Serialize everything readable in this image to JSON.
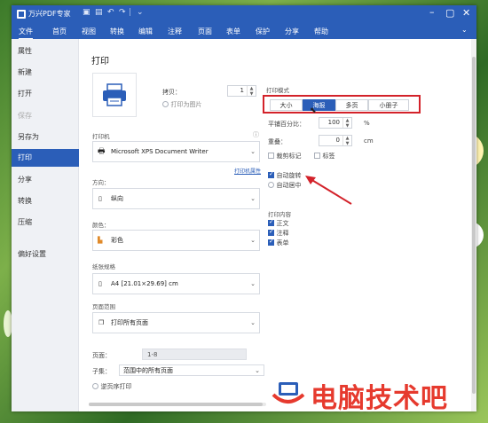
{
  "window": {
    "app_title": "万兴PDF专家",
    "quick_icons": [
      "save-icon",
      "print-icon",
      "undo-icon",
      "redo-icon",
      "customize-icon"
    ],
    "controls": [
      "minimize-icon",
      "maximize-icon",
      "close-icon"
    ]
  },
  "menubar": {
    "items": [
      "文件",
      "首页",
      "视图",
      "转换",
      "编辑",
      "注释",
      "页面",
      "表单",
      "保护",
      "分享",
      "帮助"
    ],
    "active": "文件"
  },
  "sidebar": {
    "items": [
      {
        "label": "属性",
        "state": "normal"
      },
      {
        "label": "新建",
        "state": "normal"
      },
      {
        "label": "打开",
        "state": "normal"
      },
      {
        "label": "保存",
        "state": "disabled"
      },
      {
        "label": "另存为",
        "state": "normal"
      },
      {
        "label": "打印",
        "state": "active"
      },
      {
        "label": "分享",
        "state": "normal"
      },
      {
        "label": "转换",
        "state": "normal"
      },
      {
        "label": "压缩",
        "state": "normal"
      },
      {
        "label": "偏好设置",
        "state": "normal"
      }
    ]
  },
  "print": {
    "title": "打印",
    "copies_label": "拷贝：",
    "copies_value": "1",
    "print_as_image_label": "打印为图片",
    "printer_label": "打印机",
    "printer_value": "Microsoft XPS Document Writer",
    "printer_properties_link": "打印机属性",
    "orientation_label": "方向：",
    "orientation_value": "纵向",
    "color_label": "颜色：",
    "color_value": "彩色",
    "paper_label": "纸张规格",
    "paper_value": "A4 [21.01×29.69] cm",
    "page_range_label": "页面范围",
    "page_range_value": "打印所有页面",
    "pages_label": "页面：",
    "pages_value": "1-8",
    "subset_label": "子集：",
    "subset_value": "范围中的所有页面",
    "reverse_label": "逆页序打印"
  },
  "mode": {
    "label": "打印模式",
    "options": [
      "大小",
      "海报",
      "多页",
      "小册子"
    ],
    "selected": "海报",
    "tile_scale_label": "平铺百分比：",
    "tile_scale_value": "100",
    "tile_scale_unit": "%",
    "overlap_label": "重叠：",
    "overlap_value": "0",
    "overlap_unit": "cm",
    "cut_marks_label": "裁剪标记",
    "labels_label": "标签",
    "auto_rotate_label": "自动旋转",
    "auto_center_label": "自动居中"
  },
  "content": {
    "label": "打印内容",
    "items": [
      {
        "label": "正文",
        "checked": true
      },
      {
        "label": "注释",
        "checked": true
      },
      {
        "label": "表单",
        "checked": true
      }
    ]
  },
  "watermark_text": "电脑技术吧",
  "colors": {
    "brand": "#2b5eb8",
    "highlight": "#d3222a",
    "watermark": "#e63a2e"
  }
}
